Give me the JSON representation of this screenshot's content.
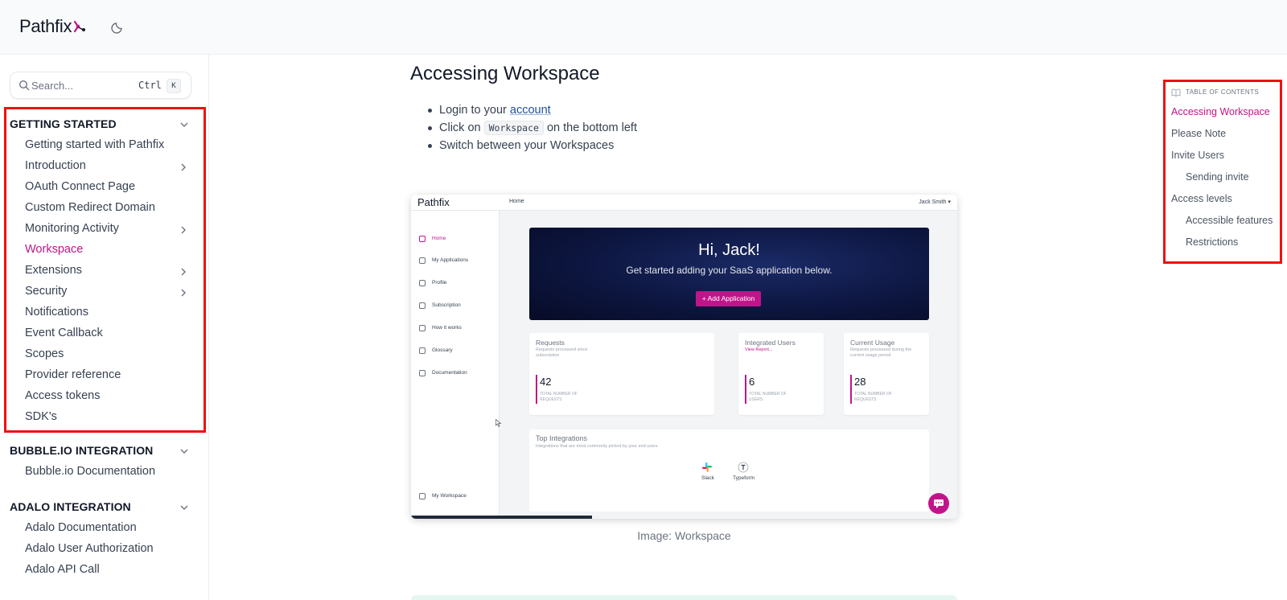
{
  "header": {
    "logo_text": "Pathfix",
    "theme_toggle": "moon-icon"
  },
  "search": {
    "placeholder": "Search...",
    "shortcut_ctrl": "Ctrl",
    "shortcut_key": "K"
  },
  "sidebar": {
    "sections": [
      {
        "title": "GETTING STARTED",
        "items": [
          {
            "label": "Getting started with Pathfix",
            "expandable": false
          },
          {
            "label": "Introduction",
            "expandable": true
          },
          {
            "label": "OAuth Connect Page",
            "expandable": false
          },
          {
            "label": "Custom Redirect Domain",
            "expandable": false
          },
          {
            "label": "Monitoring Activity",
            "expandable": true
          },
          {
            "label": "Workspace",
            "expandable": false,
            "active": true
          },
          {
            "label": "Extensions",
            "expandable": true
          },
          {
            "label": "Security",
            "expandable": true
          },
          {
            "label": "Notifications",
            "expandable": false
          },
          {
            "label": "Event Callback",
            "expandable": false
          },
          {
            "label": "Scopes",
            "expandable": false
          },
          {
            "label": "Provider reference",
            "expandable": false
          },
          {
            "label": "Access tokens",
            "expandable": false
          },
          {
            "label": "SDK's",
            "expandable": false
          }
        ]
      },
      {
        "title": "BUBBLE.IO INTEGRATION",
        "items": [
          {
            "label": "Bubble.io Documentation",
            "expandable": false
          }
        ]
      },
      {
        "title": "ADALO INTEGRATION",
        "items": [
          {
            "label": "Adalo Documentation",
            "expandable": false
          },
          {
            "label": "Adalo User Authorization",
            "expandable": false
          },
          {
            "label": "Adalo API Call",
            "expandable": false
          }
        ]
      }
    ]
  },
  "main": {
    "title": "Accessing Workspace",
    "bullets": {
      "b1_prefix": "Login to your ",
      "b1_link": "account",
      "b2_prefix": "Click on ",
      "b2_code": "Workspace",
      "b2_suffix": " on the bottom left",
      "b3": "Switch between your Workspaces"
    },
    "figure": {
      "logo": "Pathfix",
      "breadcrumb": "Home",
      "user": "Jack Smith ▾",
      "side_items": [
        "Home",
        "My Applications",
        "Profile",
        "Subscription",
        "How it works",
        "Glossary",
        "Documentation"
      ],
      "side_bottom": "My Workspace",
      "hero_title": "Hi, Jack!",
      "hero_subtitle": "Get started adding your SaaS application below.",
      "hero_button": "+ Add Application",
      "cards": [
        {
          "title": "Requests",
          "subtitle": "Requests processed since subscription",
          "value": "42",
          "label": "TOTAL NUMBER OF REQUESTS"
        },
        {
          "title": "Integrated Users",
          "subtitle": "View Report...",
          "value": "6",
          "label": "TOTAL NUMBER OF USERS"
        },
        {
          "title": "Current Usage",
          "subtitle": "Requests processed during the current usage period",
          "value": "28",
          "label": "TOTAL NUMBER OF REQUESTS"
        }
      ],
      "integrations_title": "Top Integrations",
      "integrations_subtitle": "Integrations that are most commonly picked by your end users",
      "integrations": [
        "Slack",
        "Typeform"
      ]
    },
    "caption": "Image: Workspace"
  },
  "toc": {
    "heading": "TABLE OF CONTENTS",
    "items": [
      {
        "label": "Accessing Workspace",
        "level": 1,
        "active": true
      },
      {
        "label": "Please Note",
        "level": 1
      },
      {
        "label": "Invite Users",
        "level": 1
      },
      {
        "label": "Sending invite",
        "level": 2
      },
      {
        "label": "Access levels",
        "level": 1
      },
      {
        "label": "Accessible features",
        "level": 2
      },
      {
        "label": "Restrictions",
        "level": 2
      }
    ]
  },
  "colors": {
    "accent": "#c0158a",
    "highlight_box": "#ef1010",
    "link": "#1e4fa0"
  }
}
